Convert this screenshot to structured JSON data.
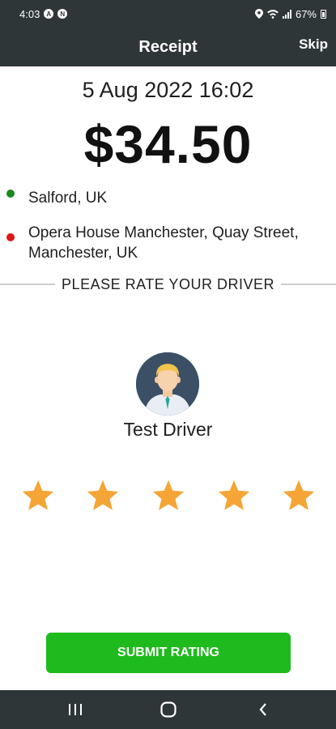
{
  "status_bar": {
    "time": "4:03",
    "battery": "67%",
    "icons": [
      "a-icon",
      "n-icon",
      "location-icon",
      "wifi-icon",
      "signal-icon",
      "battery-icon"
    ]
  },
  "app_bar": {
    "title": "Receipt",
    "skip_label": "Skip"
  },
  "receipt": {
    "date": "5 Aug 2022 16:02",
    "amount": "$34.50",
    "pickup": "Salford, UK",
    "dropoff": "Opera House Manchester, Quay Street, Manchester, UK"
  },
  "rating": {
    "heading": "PLEASE RATE YOUR DRIVER",
    "driver_name": "Test Driver",
    "star_count": 5,
    "selected_stars": 5
  },
  "submit_label": "SUBMIT RATING",
  "colors": {
    "bars": "#2e3638",
    "pickup_dot": "#1a8a1a",
    "dropoff_dot": "#e01515",
    "star": "#f5a536",
    "submit": "#1fba1d",
    "avatar_bg": "#3b5065"
  },
  "nav_bar": {
    "icons": [
      "recent-apps-icon",
      "home-icon",
      "back-icon"
    ]
  }
}
